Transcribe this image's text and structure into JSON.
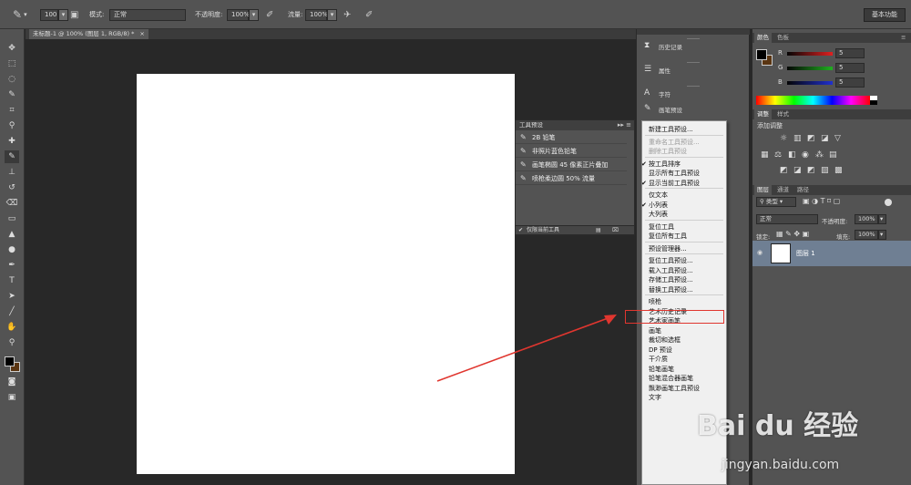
{
  "options_bar": {
    "brush_size": "100",
    "mode_label": "模式:",
    "mode_value": "正常",
    "opacity_label": "不透明度:",
    "opacity_value": "100%",
    "flow_label": "流量:",
    "flow_value": "100%",
    "workspace_label": "基本功能"
  },
  "document": {
    "tab_title": "未标题-1 @ 100% (图层 1, RGB/8) *",
    "canvas_color": "#ffffff"
  },
  "tools": [
    "move-tool",
    "marquee-tool",
    "lasso-tool",
    "quick-select-tool",
    "crop-tool",
    "eyedropper-tool",
    "healing-tool",
    "brush-tool",
    "clone-stamp-tool",
    "history-brush-tool",
    "eraser-tool",
    "gradient-tool",
    "blur-tool",
    "dodge-tool",
    "pen-tool",
    "type-tool",
    "path-select-tool",
    "shape-tool",
    "hand-tool",
    "zoom-tool"
  ],
  "tool_presets_panel": {
    "title": "工具预设",
    "items": [
      "2B 铅笔",
      "非照片蓝色铅笔",
      "画笔椭圆 45 像素正片叠加",
      "喷枪柔边圆 50% 流量"
    ],
    "footer_checkbox": "仅限当前工具"
  },
  "mid_panel": {
    "items": [
      {
        "icon": "history-icon",
        "label": "历史记录"
      },
      {
        "icon": "properties-icon",
        "label": "属性"
      },
      {
        "icon": "character-icon",
        "label": "字符"
      },
      {
        "icon": "brush-presets-icon",
        "label": "画笔预设"
      }
    ]
  },
  "context_menu": {
    "items": [
      {
        "label": "新建工具预设...",
        "disabled": false,
        "checked": false
      },
      {
        "sep": true
      },
      {
        "label": "重命名工具预设...",
        "disabled": true,
        "checked": false
      },
      {
        "label": "删除工具预设",
        "disabled": true,
        "checked": false
      },
      {
        "sep": true
      },
      {
        "label": "按工具排序",
        "disabled": false,
        "checked": true
      },
      {
        "label": "显示所有工具预设",
        "disabled": false,
        "checked": false
      },
      {
        "label": "显示当前工具预设",
        "disabled": false,
        "checked": true
      },
      {
        "sep": true
      },
      {
        "label": "仅文本",
        "disabled": false,
        "checked": false
      },
      {
        "label": "小列表",
        "disabled": false,
        "checked": true
      },
      {
        "label": "大列表",
        "disabled": false,
        "checked": false
      },
      {
        "sep": true
      },
      {
        "label": "复位工具",
        "disabled": false,
        "checked": false
      },
      {
        "label": "复位所有工具",
        "disabled": false,
        "checked": false
      },
      {
        "sep": true
      },
      {
        "label": "预设管理器...",
        "disabled": false,
        "checked": false
      },
      {
        "sep": true
      },
      {
        "label": "复位工具预设...",
        "disabled": false,
        "checked": false
      },
      {
        "label": "载入工具预设...",
        "disabled": false,
        "checked": false
      },
      {
        "label": "存储工具预设...",
        "disabled": false,
        "checked": false
      },
      {
        "label": "替换工具预设...",
        "disabled": false,
        "checked": false
      },
      {
        "sep": true
      },
      {
        "label": "喷枪",
        "disabled": false,
        "checked": false
      },
      {
        "label": "艺术历史记录",
        "disabled": false,
        "checked": false
      },
      {
        "label": "艺术家画笔",
        "disabled": false,
        "checked": false
      },
      {
        "label": "画笔",
        "disabled": false,
        "checked": false
      },
      {
        "label": "裁切和选框",
        "disabled": false,
        "checked": false
      },
      {
        "label": "DP 预设",
        "disabled": false,
        "checked": false
      },
      {
        "label": "干介质",
        "disabled": false,
        "checked": false
      },
      {
        "label": "铅笔画笔",
        "disabled": false,
        "checked": false
      },
      {
        "label": "铅笔混合器画笔",
        "disabled": false,
        "checked": false
      },
      {
        "label": "飘渺画笔工具预设",
        "disabled": false,
        "checked": false
      },
      {
        "label": "文字",
        "disabled": false,
        "checked": false
      }
    ],
    "highlighted_label": "载入工具预设..."
  },
  "color_panel": {
    "tabs": [
      "颜色",
      "色板"
    ],
    "channels": [
      {
        "label": "R",
        "value": "5",
        "color": "#e02020"
      },
      {
        "label": "G",
        "value": "5",
        "color": "#20b020"
      },
      {
        "label": "B",
        "value": "5",
        "color": "#2030d0"
      }
    ],
    "foreground": "#000000",
    "background": "#5a3512"
  },
  "adjustments_panel": {
    "tabs": [
      "调整",
      "样式"
    ],
    "title": "添加调整"
  },
  "layers_panel": {
    "tabs": [
      "图层",
      "通道",
      "路径"
    ],
    "filter_label": "类型",
    "blend_mode": "正常",
    "opacity_label": "不透明度:",
    "opacity_value": "100%",
    "lock_label": "锁定:",
    "fill_label": "填充:",
    "fill_value": "100%",
    "layer_name": "图层 1"
  },
  "watermark": {
    "brand": "Bai du 经验",
    "url": "jingyan.baidu.com"
  },
  "accent_color": "#e0362f"
}
